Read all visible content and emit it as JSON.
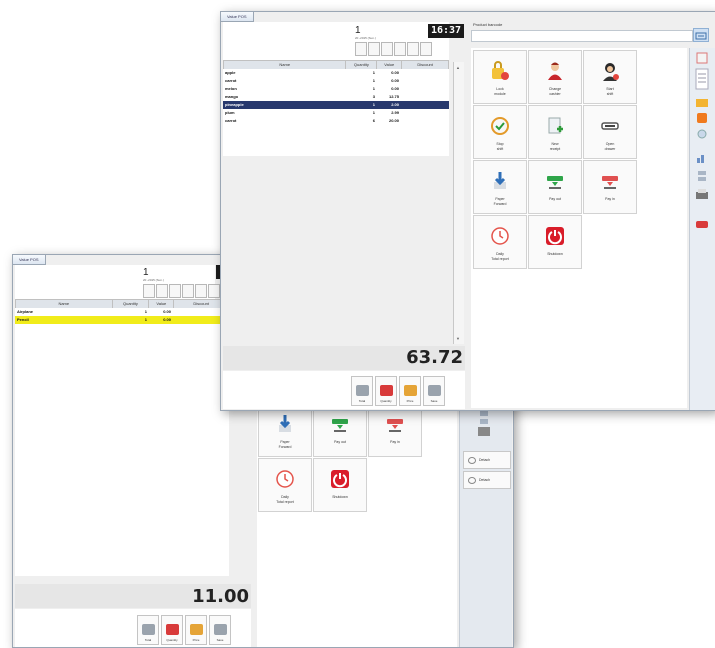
{
  "back_window": {
    "tab": "Value POS",
    "receipt_number": "1",
    "receipt_sub": "20 -2015 (Sun.)",
    "columns": [
      "Name",
      "Quantity",
      "Value",
      "Discount"
    ],
    "rows": [
      {
        "name": "Airplane",
        "qty": "1",
        "value": "0.00",
        "discount": ""
      },
      {
        "name": "Pencil",
        "qty": "1",
        "value": "0.00",
        "discount": ""
      }
    ],
    "selected_row": 1,
    "total": "11.00",
    "function_keys": [
      "Total",
      "Quantity",
      "Price",
      "Save"
    ],
    "tiles": [
      {
        "label": "Paper\nForward"
      },
      {
        "label": "Pay out"
      },
      {
        "label": "Pay in"
      },
      {
        "label": "Daily\nTotal report"
      },
      {
        "label": "Shutdown"
      }
    ],
    "side_buttons": [
      "Detach",
      "Detach"
    ]
  },
  "front_window": {
    "tab": "Value POS",
    "receipt_number": "1",
    "receipt_sub": "20 -2015 (Sun.)",
    "clock": "16:37",
    "columns": [
      "Name",
      "Quantity",
      "Value",
      "Discount"
    ],
    "rows": [
      {
        "name": "apple",
        "qty": "1",
        "value": "0.00",
        "discount": ""
      },
      {
        "name": "carrot",
        "qty": "1",
        "value": "0.00",
        "discount": ""
      },
      {
        "name": "melon",
        "qty": "1",
        "value": "0.00",
        "discount": ""
      },
      {
        "name": "mango",
        "qty": "3",
        "value": "12.75",
        "discount": ""
      },
      {
        "name": "pineapple",
        "qty": "1",
        "value": "2.00",
        "discount": ""
      },
      {
        "name": "plum",
        "qty": "1",
        "value": "2.99",
        "discount": ""
      },
      {
        "name": "carrot",
        "qty": "6",
        "value": "20.00",
        "discount": ""
      }
    ],
    "selected_row": 4,
    "total": "63.72",
    "function_keys": [
      "Total",
      "Quantity",
      "Price",
      "Save"
    ],
    "search_label": "Product barcode",
    "tiles": [
      {
        "label": "Lock\nmodule",
        "icon": "lock-user-icon"
      },
      {
        "label": "Change\ncashier",
        "icon": "cashier-icon"
      },
      {
        "label": "Start\nshift",
        "icon": "start-shift-icon"
      },
      {
        "label": "Stop\nshift",
        "icon": "stop-shift-icon"
      },
      {
        "label": "New\nreceipt",
        "icon": "new-receipt-icon"
      },
      {
        "label": "Open\ndrawer",
        "icon": "drawer-icon"
      },
      {
        "label": "Paper\nForward",
        "icon": "paper-forward-icon"
      },
      {
        "label": "Pay out",
        "icon": "pay-out-icon"
      },
      {
        "label": "Pay in",
        "icon": "pay-in-icon"
      },
      {
        "label": "Daily\nTotal report",
        "icon": "daily-report-icon"
      },
      {
        "label": "Shutdown",
        "icon": "shutdown-icon"
      }
    ]
  },
  "colors": {
    "selection_blue": "#27386d",
    "selection_yellow": "#f1ec1a",
    "shutdown_red": "#d91d2a",
    "clock_bg": "#1b1b1b"
  }
}
